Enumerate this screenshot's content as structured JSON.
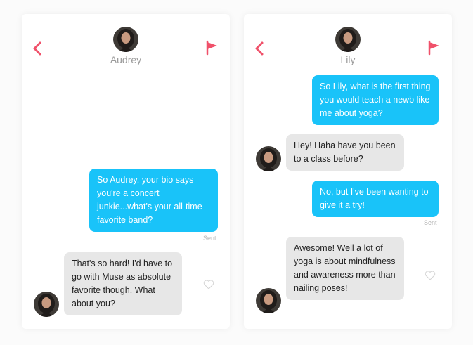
{
  "colors": {
    "accent": "#f0516a",
    "outgoing_bubble": "#19c3f9",
    "incoming_bubble": "#e7e7e7"
  },
  "conversations": [
    {
      "name": "Audrey",
      "messages": [
        {
          "direction": "outgoing",
          "text": "So Audrey, your bio says you're a concert junkie...what's your all-time favorite band?",
          "status": "Sent"
        },
        {
          "direction": "incoming",
          "text": "That's so hard! I'd have to go with Muse as absolute favorite though. What about you?",
          "liked": false
        }
      ]
    },
    {
      "name": "Lily",
      "messages": [
        {
          "direction": "outgoing",
          "text": "So Lily, what is the first thing you would teach a newb like me about yoga?"
        },
        {
          "direction": "incoming",
          "text": "Hey! Haha have you been to a class before?"
        },
        {
          "direction": "outgoing",
          "text": "No, but I've been wanting to give it a try!",
          "status": "Sent"
        },
        {
          "direction": "incoming",
          "text": "Awesome! Well a lot of yoga is about mindfulness and awareness more than nailing poses!",
          "liked": false
        }
      ]
    }
  ],
  "icons": {
    "back": "chevron-left-icon",
    "report": "flag-icon",
    "like": "heart-outline-icon"
  }
}
